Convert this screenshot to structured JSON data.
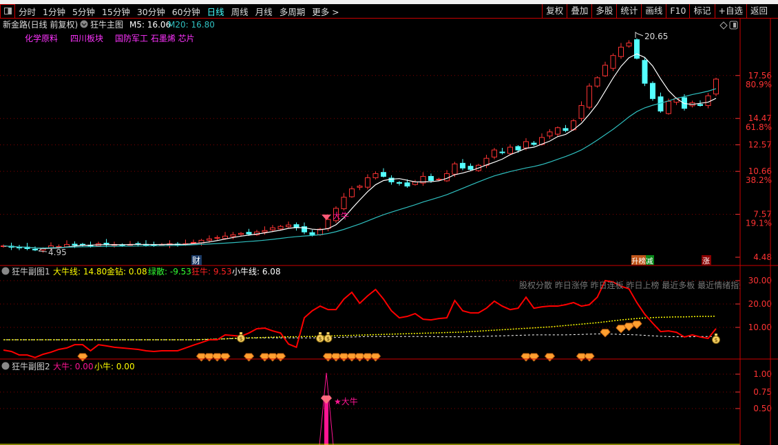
{
  "toolbar": {
    "periods": [
      "分时",
      "1分钟",
      "5分钟",
      "15分钟",
      "30分钟",
      "60分钟",
      "日线",
      "周线",
      "月线",
      "多周期",
      "更多 >"
    ],
    "active": "日线",
    "right_buttons": [
      "复权",
      "叠加",
      "多股",
      "统计",
      "画线",
      "F10",
      "标记",
      "+自选",
      "返回"
    ]
  },
  "main": {
    "title": "新金路(日线 前复权)",
    "indicator": "狂牛主图",
    "m5_label": "M5: 16.06",
    "m20_label": "M20: 16.80",
    "sectors": [
      "化学原料",
      "四川板块",
      "国防军工 石墨烯 芯片"
    ],
    "high_label": "20.65",
    "low_label": "4.95",
    "signal_label": "大牛",
    "badges": {
      "cai": "财",
      "rank_up": "升榜",
      "reduce": "减",
      "rise": "涨"
    },
    "axis": [
      {
        "price": "17.56",
        "pct": "80.9%"
      },
      {
        "price": "14.47",
        "pct": "61.8%"
      },
      {
        "price": "12.57",
        "pct": ""
      },
      {
        "price": "10.66",
        "pct": "38.2%"
      },
      {
        "price": "7.57",
        "pct": "19.1%"
      },
      {
        "price": "4.48",
        "pct": ""
      }
    ]
  },
  "sub1": {
    "title": "狂牛副图1",
    "big_line": "大牛线: 14.80",
    "gold": "金钻: 0.08",
    "green": "绿散: -9.53",
    "bull": "狂牛: 9.53",
    "small_line": "小牛线: 6.08",
    "overlay": "股权分散 昨日涨停 昨日连板 昨日上榜 最近多板 最近情绪指数",
    "axis": [
      "30.00",
      "20.00",
      "10.00"
    ]
  },
  "sub2": {
    "title": "狂牛副图2",
    "big": "大牛: 0.00",
    "small": "小牛: 0.00",
    "signal_label": "★大牛",
    "axis": [
      "1.00",
      "0.75",
      "0.50"
    ]
  },
  "colors": {
    "up": "#ff3333",
    "down": "#54ffff",
    "ma5": "#ffffff",
    "ma20": "#2fc0c0",
    "bull": "#ff0000",
    "big_line": "#ffff00",
    "small_line": "#ffffff",
    "border": "#cc0000"
  },
  "chart_data": [
    {
      "type": "candlestick",
      "name": "狂牛主图",
      "ylim": [
        4.48,
        20.65
      ],
      "close": [
        5.3,
        5.2,
        5.15,
        5.1,
        5.0,
        5.1,
        5.3,
        5.25,
        5.4,
        5.35,
        5.4,
        5.3,
        5.45,
        5.4,
        5.4,
        5.35,
        5.4,
        5.45,
        5.4,
        5.35,
        5.4,
        5.45,
        5.4,
        5.45,
        5.55,
        5.7,
        5.8,
        5.9,
        6.0,
        6.1,
        6.2,
        6.15,
        6.3,
        6.4,
        6.6,
        6.7,
        6.8,
        6.6,
        6.3,
        6.1,
        6.5,
        7.2,
        8.0,
        8.8,
        9.4,
        9.6,
        10.2,
        10.5,
        10.3,
        9.9,
        9.8,
        9.6,
        9.9,
        10.3,
        10.0,
        10.1,
        10.5,
        11.2,
        10.9,
        10.8,
        11.1,
        11.6,
        12.2,
        12.0,
        12.4,
        12.2,
        12.8,
        12.6,
        13.1,
        13.5,
        13.8,
        13.6,
        14.3,
        15.4,
        16.8,
        17.4,
        18.3,
        19.0,
        19.6,
        19.9,
        18.8,
        17.0,
        15.9,
        15.0,
        15.7,
        15.9,
        15.2,
        15.6,
        15.4,
        16.1,
        17.3
      ]
    },
    {
      "type": "line",
      "name": "狂牛副图1",
      "ylim": [
        -3.5,
        31
      ],
      "bull": [
        0.3,
        -0.3,
        -1.8,
        -1.8,
        -2.9,
        -1.5,
        -0.6,
        0.6,
        1.2,
        2.6,
        2.6,
        0,
        2.6,
        2.1,
        1.5,
        1.2,
        0.9,
        0.6,
        0,
        -0.3,
        0,
        0,
        0,
        1.2,
        2.4,
        3.5,
        4.7,
        4.7,
        6.8,
        6.5,
        6.2,
        7.6,
        9.4,
        9.7,
        8.5,
        7.6,
        2.9,
        1.5,
        14.1,
        17.1,
        19.1,
        17.6,
        17.6,
        22.1,
        25.0,
        20.3,
        23.5,
        26.2,
        22.1,
        17.1,
        14.1,
        14.7,
        15.9,
        13.5,
        13.2,
        13.8,
        14.1,
        21.5,
        17.1,
        16.2,
        16.2,
        18.2,
        21.2,
        19.1,
        17.6,
        18.2,
        22.9,
        18.2,
        18.8,
        19.1,
        19.1,
        19.7,
        20.6,
        19.1,
        19.7,
        22.9,
        30.0,
        29.4,
        27.6,
        26.5,
        20.6,
        15.6,
        11.8,
        8.2,
        8.5,
        7.9,
        5.9,
        6.8,
        5.9,
        5.3,
        9.5
      ],
      "big_line": [
        4.7,
        4.7,
        4.7,
        4.7,
        4.7,
        4.7,
        4.7,
        4.7,
        4.7,
        4.7,
        4.7,
        4.7,
        4.7,
        4.7,
        4.7,
        4.7,
        4.7,
        4.7,
        4.7,
        4.7,
        4.7,
        4.7,
        4.7,
        4.7,
        4.7,
        4.8,
        4.9,
        5.0,
        5.1,
        5.3,
        5.4,
        5.5,
        5.6,
        5.7,
        5.8,
        5.9,
        6.0,
        6.0,
        6.1,
        6.1,
        6.2,
        6.3,
        6.4,
        6.5,
        6.6,
        6.7,
        6.8,
        6.9,
        7.0,
        7.1,
        7.2,
        7.3,
        7.4,
        7.5,
        7.6,
        7.7,
        7.8,
        7.9,
        8.0,
        8.2,
        8.4,
        8.6,
        8.8,
        9.0,
        9.2,
        9.4,
        9.6,
        9.8,
        10.0,
        10.2,
        10.5,
        10.8,
        11.1,
        11.4,
        11.7,
        12.0,
        12.4,
        12.8,
        13.2,
        13.5,
        13.8,
        14.0,
        14.2,
        14.3,
        14.4,
        14.5,
        14.5,
        14.6,
        14.7,
        14.7,
        14.8
      ],
      "small_line": [
        4.7,
        4.7,
        4.7,
        4.7,
        4.7,
        4.7,
        4.7,
        4.7,
        4.7,
        4.7,
        4.7,
        4.7,
        4.7,
        4.7,
        4.7,
        4.7,
        4.7,
        4.7,
        4.7,
        4.7,
        4.7,
        4.7,
        4.7,
        4.7,
        4.7,
        4.8,
        4.9,
        5.0,
        5.1,
        5.2,
        5.3,
        5.4,
        5.5,
        5.5,
        5.5,
        5.5,
        5.5,
        5.5,
        5.5,
        5.5,
        5.6,
        5.6,
        5.7,
        5.8,
        5.9,
        6.0,
        6.1,
        6.1,
        6.1,
        6.1,
        6.1,
        6.1,
        6.1,
        6.1,
        6.1,
        6.0,
        6.0,
        6.0,
        6.0,
        6.1,
        6.1,
        6.2,
        6.3,
        6.4,
        6.5,
        6.6,
        6.7,
        6.8,
        6.8,
        6.8,
        6.8,
        6.8,
        6.9,
        7.0,
        7.1,
        7.2,
        7.2,
        7.1,
        7.0,
        6.9,
        6.8,
        6.6,
        6.4,
        6.2,
        6.1,
        6.0,
        6.0,
        6.0,
        6.1,
        6.1,
        6.08
      ],
      "gold_diamond_bars": [
        10,
        25,
        26,
        27,
        28,
        31,
        33,
        34,
        35,
        41,
        42,
        43,
        44,
        45,
        46,
        47,
        66,
        67,
        69,
        73,
        74,
        76,
        78,
        79,
        80
      ],
      "money_bag_bars": [
        30,
        40,
        41,
        90
      ]
    },
    {
      "type": "bar",
      "name": "狂牛副图2",
      "ylim": [
        0,
        1.05
      ],
      "big_bull_bars": [
        40
      ],
      "value": 1.0
    }
  ]
}
